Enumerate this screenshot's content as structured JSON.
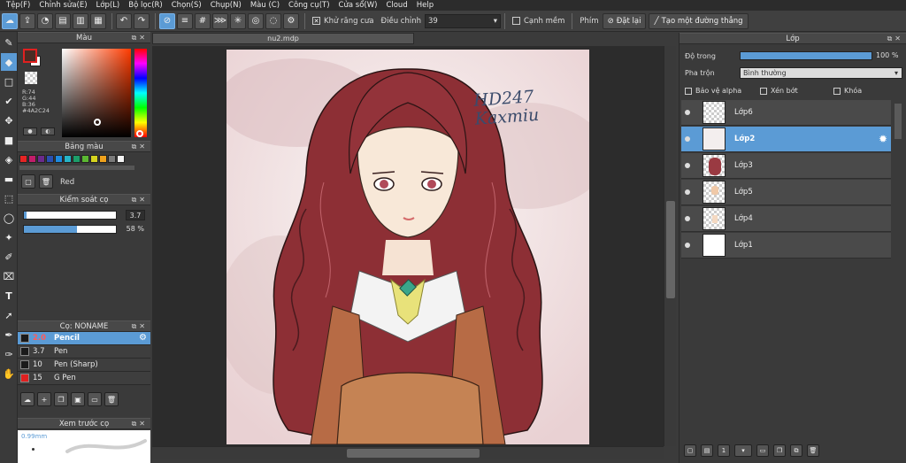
{
  "menu": [
    "Tệp(F)",
    "Chỉnh sửa(E)",
    "Lớp(L)",
    "Bộ lọc(R)",
    "Chọn(S)",
    "Chụp(N)",
    "Màu (C)",
    "Công cụ(T)",
    "Cửa sổ(W)",
    "Cloud",
    "Help"
  ],
  "toolbar": {
    "antialias_label": "Khử răng cưa",
    "adjust_label": "Điều chỉnh",
    "adjust_value": "39",
    "smooth_label": "Cạnh mềm",
    "key_label": "Phím",
    "reset_label": "Đặt lại",
    "straight_line_label": "Tạo một đường thẳng"
  },
  "color_panel": {
    "title": "Màu",
    "fg_color": "#4A2C24",
    "rgb_r": "R:74",
    "rgb_g": "G:44",
    "rgb_b": "B:36",
    "hex": "#4A2C24"
  },
  "palette_panel": {
    "title": "Bảng màu",
    "selected_name": "Red",
    "colors": [
      "#e62424",
      "#c21d6a",
      "#6b2a8c",
      "#2a4fb0",
      "#1d8be0",
      "#25b5c8",
      "#1c9e6a",
      "#5bb832",
      "#d6d41e",
      "#f0a21c",
      "#7a7a7a",
      "#f4f4f4"
    ]
  },
  "brush_control": {
    "title": "Kiểm soát cọ",
    "size_value": "3.7",
    "size_fraction": 0.03,
    "opacity_value": "58 %",
    "opacity_fraction": 0.58
  },
  "brush_panel": {
    "title": "Cọ: NONAME",
    "items": [
      {
        "size": "2.0",
        "name": "Pencil",
        "selected": true,
        "color": "#1a1a1a"
      },
      {
        "size": "3.7",
        "name": "Pen",
        "selected": false,
        "color": "#1a1a1a"
      },
      {
        "size": "10",
        "name": "Pen (Sharp)",
        "selected": false,
        "color": "#1a1a1a"
      },
      {
        "size": "15",
        "name": "G Pen",
        "selected": false,
        "color": "#e02020"
      }
    ]
  },
  "preview_panel": {
    "title": "Xem trước cọ",
    "size_text": "0.99mm"
  },
  "document": {
    "tab_title": "nu2.mdp",
    "signature": "HD247 Kaxmiu"
  },
  "layer_panel": {
    "title": "Lớp",
    "opacity_label": "Độ trong",
    "opacity_value": "100 %",
    "blend_label": "Pha trộn",
    "blend_value": "Bình thường",
    "protect_alpha_label": "Bảo vệ alpha",
    "clipping_label": "Xén bớt",
    "lock_label": "Khóa",
    "layers": [
      {
        "name": "Lớp6",
        "selected": false
      },
      {
        "name": "Lớp2",
        "selected": true
      },
      {
        "name": "Lớp3",
        "selected": false
      },
      {
        "name": "Lớp5",
        "selected": false
      },
      {
        "name": "Lớp4",
        "selected": false
      },
      {
        "name": "Lớp1",
        "selected": false
      }
    ]
  }
}
